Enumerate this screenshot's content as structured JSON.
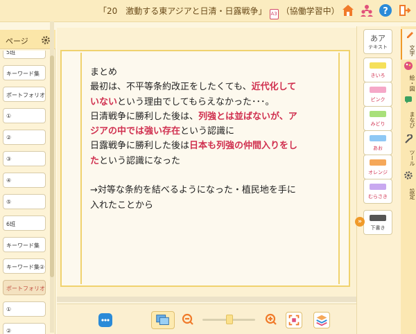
{
  "header": {
    "title_prefix": "「20　激動する東アジアと日清・日露戦争」",
    "doc_icon_label": "A3",
    "mode": "（協働学習中）",
    "icons": [
      "home-icon",
      "members-icon",
      "help-icon",
      "exit-icon"
    ],
    "colors": {
      "home": "#f07a2a",
      "members": "#e0507a",
      "help": "#2a8ad8",
      "exit": "#f07a2a"
    }
  },
  "sidebar": {
    "title": "ページ",
    "items": [
      {
        "label": "5班"
      },
      {
        "label": "キーワード集"
      },
      {
        "label": "ポートフォリオ"
      },
      {
        "label": "①"
      },
      {
        "label": "②"
      },
      {
        "label": "③"
      },
      {
        "label": "④"
      },
      {
        "label": "⑤"
      },
      {
        "label": "6班"
      },
      {
        "label": "キーワード集"
      },
      {
        "label": "キーワード集②"
      },
      {
        "label": "ポートフォリオ"
      },
      {
        "label": "①"
      },
      {
        "label": "②"
      }
    ],
    "selected_index": 11
  },
  "content": {
    "line1": "まとめ",
    "line2a": "最初は、不平等条約改正をしたくても、",
    "line2b": "近代化して",
    "line3a": "いない",
    "line3b": "という理由でしてもらえなかった･･･。",
    "line4a": "日清戦争に勝利した後は、",
    "line4b": "列強とは並ばないが、ア",
    "line5a": "ジアの中では強い存在",
    "line5b": "という認識に",
    "line6a": "日露戦争に勝利した後は",
    "line6b": "日本も列強の仲間入りをし",
    "line7a": "た",
    "line7b": "という認識になった",
    "line8": "→対等な条約を結べるようになった・植民地を手に",
    "line9": "入れたことから"
  },
  "pens": [
    {
      "label": "テキスト",
      "color": "#ffffff"
    },
    {
      "label": "きいろ",
      "color": "#f5e05a"
    },
    {
      "label": "ピンク",
      "color": "#f5a8c8"
    },
    {
      "label": "みどり",
      "color": "#a8e07a"
    },
    {
      "label": "あお",
      "color": "#8ec8f5"
    },
    {
      "label": "オレンジ",
      "color": "#f5a85a"
    },
    {
      "label": "むらさき",
      "color": "#c8a8f0"
    },
    {
      "label": "下書き",
      "color": "#555555"
    }
  ],
  "pen_text_icon": "あア",
  "right_tabs": [
    {
      "label": "文字",
      "icon": "pen-icon"
    },
    {
      "label": "絵・図",
      "icon": "palette-icon"
    },
    {
      "label": "まなび",
      "icon": "learn-icon"
    },
    {
      "label": "ツール",
      "icon": "wrench-icon"
    },
    {
      "label": "設定",
      "icon": "gear-icon"
    }
  ],
  "accent": "#f09a2a"
}
